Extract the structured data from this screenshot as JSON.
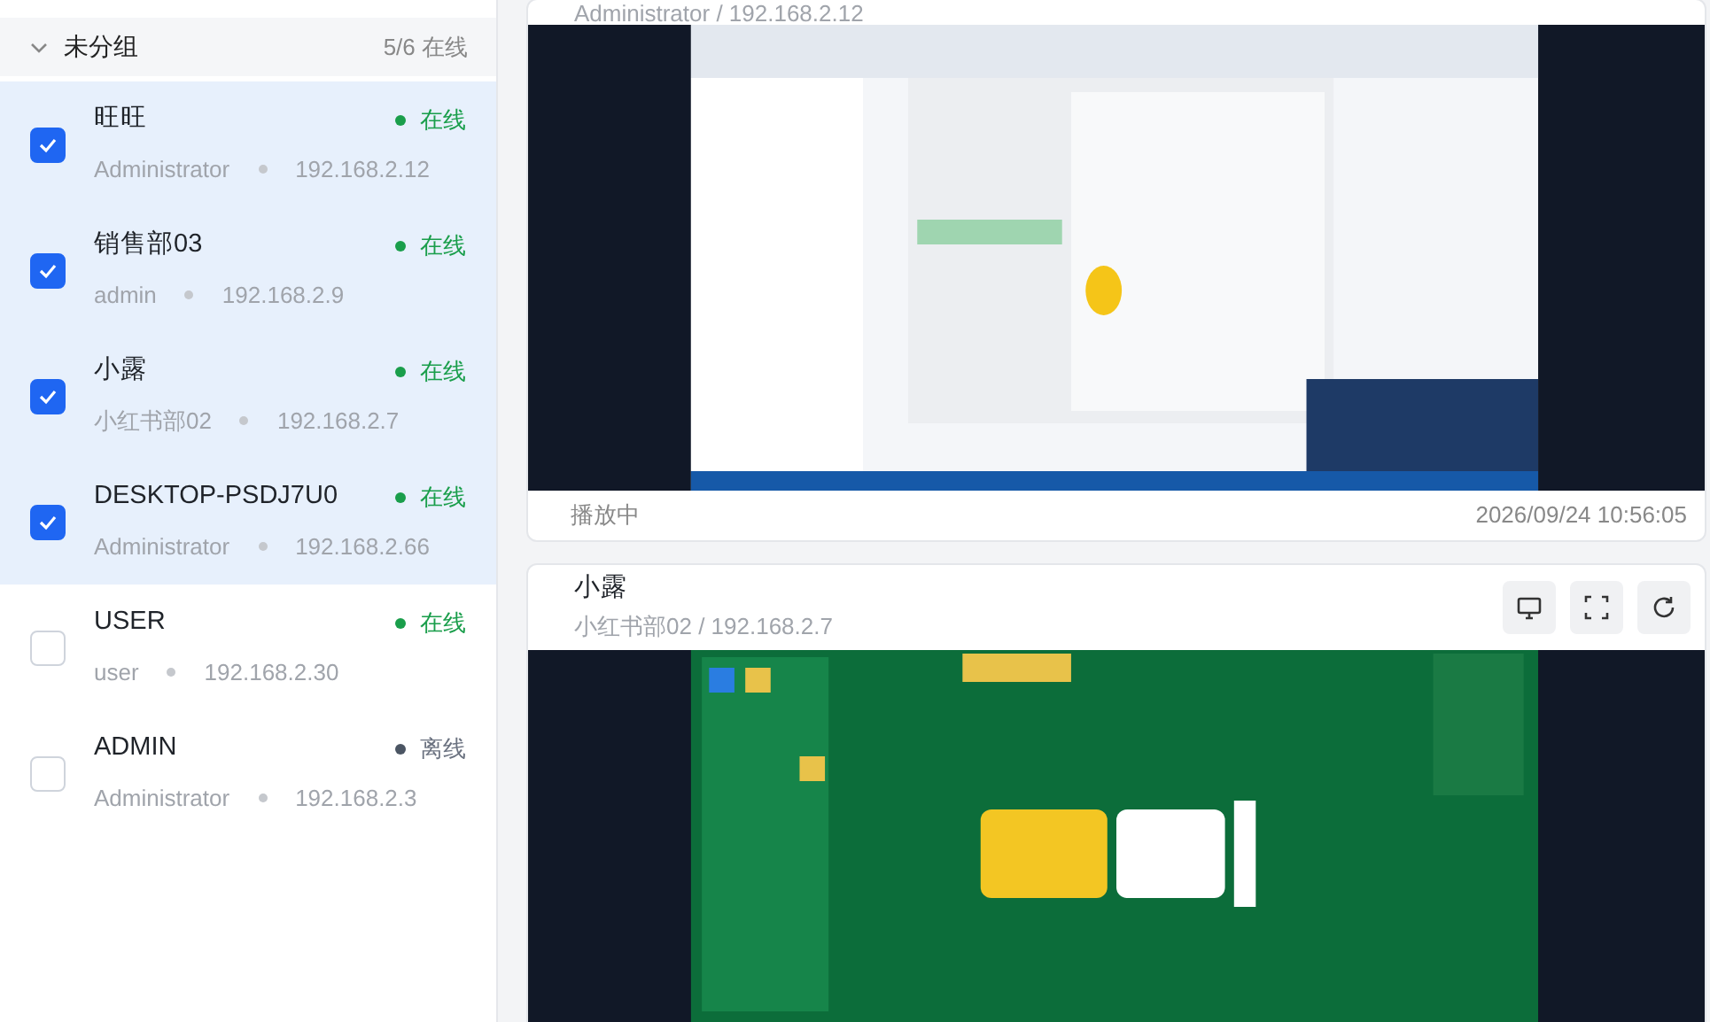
{
  "group": {
    "name": "未分组",
    "count": "5/6 在线",
    "expanded": true
  },
  "devices": [
    {
      "name": "旺旺",
      "user": "Administrator",
      "ip": "192.168.2.12",
      "status": "在线",
      "online": true,
      "selected": true
    },
    {
      "name": "销售部03",
      "user": "admin",
      "ip": "192.168.2.9",
      "status": "在线",
      "online": true,
      "selected": true
    },
    {
      "name": "小露",
      "user": "小红书部02",
      "ip": "192.168.2.7",
      "status": "在线",
      "online": true,
      "selected": true
    },
    {
      "name": "DESKTOP-PSDJ7U0",
      "user": "Administrator",
      "ip": "192.168.2.66",
      "status": "在线",
      "online": true,
      "selected": true
    },
    {
      "name": "USER",
      "user": "user",
      "ip": "192.168.2.30",
      "status": "在线",
      "online": true,
      "selected": false
    },
    {
      "name": "ADMIN",
      "user": "Administrator",
      "ip": "192.168.2.3",
      "status": "离线",
      "online": false,
      "selected": false
    }
  ],
  "streams": [
    {
      "subtitle": "Administrator / 192.168.2.12",
      "kind": "picture",
      "state": "播放中",
      "time": "2026/09/24 10:56:05"
    },
    {
      "title": "小露",
      "subtitle": "小红书部02 / 192.168.2.7",
      "buttons": [
        {
          "kind": "monitor"
        },
        {
          "kind": "fullscreen"
        },
        {
          "kind": "refresh"
        }
      ],
      "kind": "picture"
    }
  ]
}
